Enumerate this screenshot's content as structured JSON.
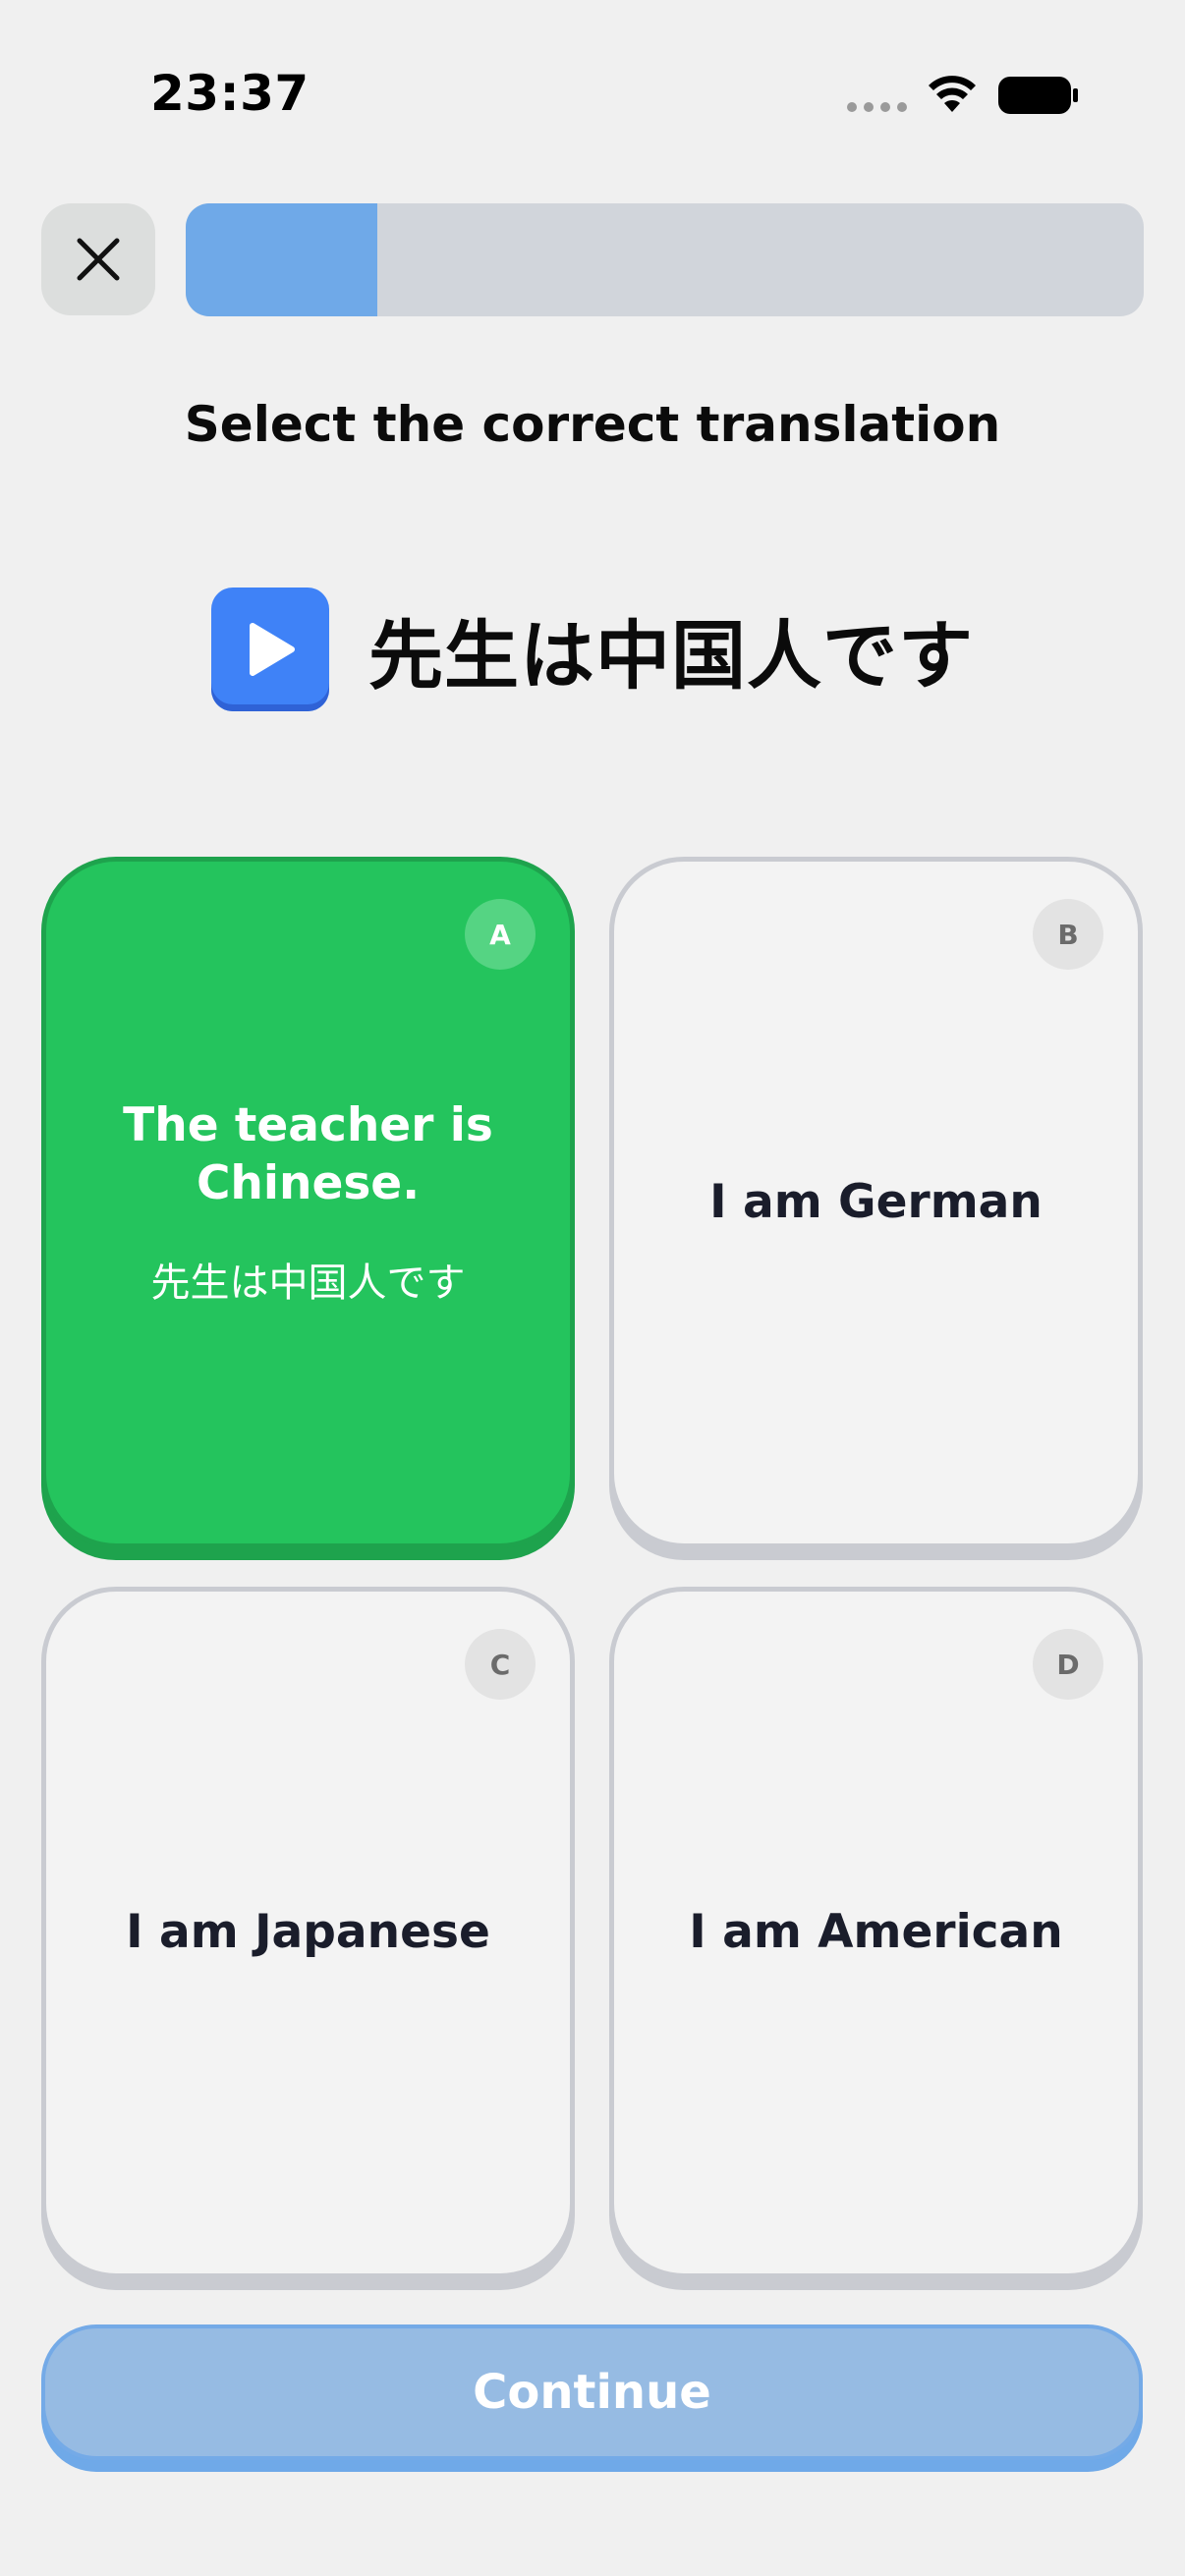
{
  "status_bar": {
    "time": "23:37",
    "icons": [
      "signal-dots-icon",
      "wifi-icon",
      "battery-icon"
    ]
  },
  "header": {
    "close_icon": "close-icon",
    "progress": 0.2
  },
  "instruction": "Select the correct translation",
  "prompt": {
    "play_icon": "play-icon",
    "text": "先生は中国人です"
  },
  "options": [
    {
      "badge": "A",
      "label": "The teacher is Chinese.",
      "sublabel": "先生は中国人です",
      "selected": true
    },
    {
      "badge": "B",
      "label": "I am German",
      "selected": false
    },
    {
      "badge": "C",
      "label": "I am Japanese",
      "selected": false
    },
    {
      "badge": "D",
      "label": "I am American",
      "selected": false
    }
  ],
  "continue_label": "Continue",
  "colors": {
    "background": "#f0f0f0",
    "selected_green": "#24c45d",
    "progress_blue": "#6fa9e8",
    "play_blue": "#3f82f7",
    "continue_disabled": "#96bbe3"
  }
}
